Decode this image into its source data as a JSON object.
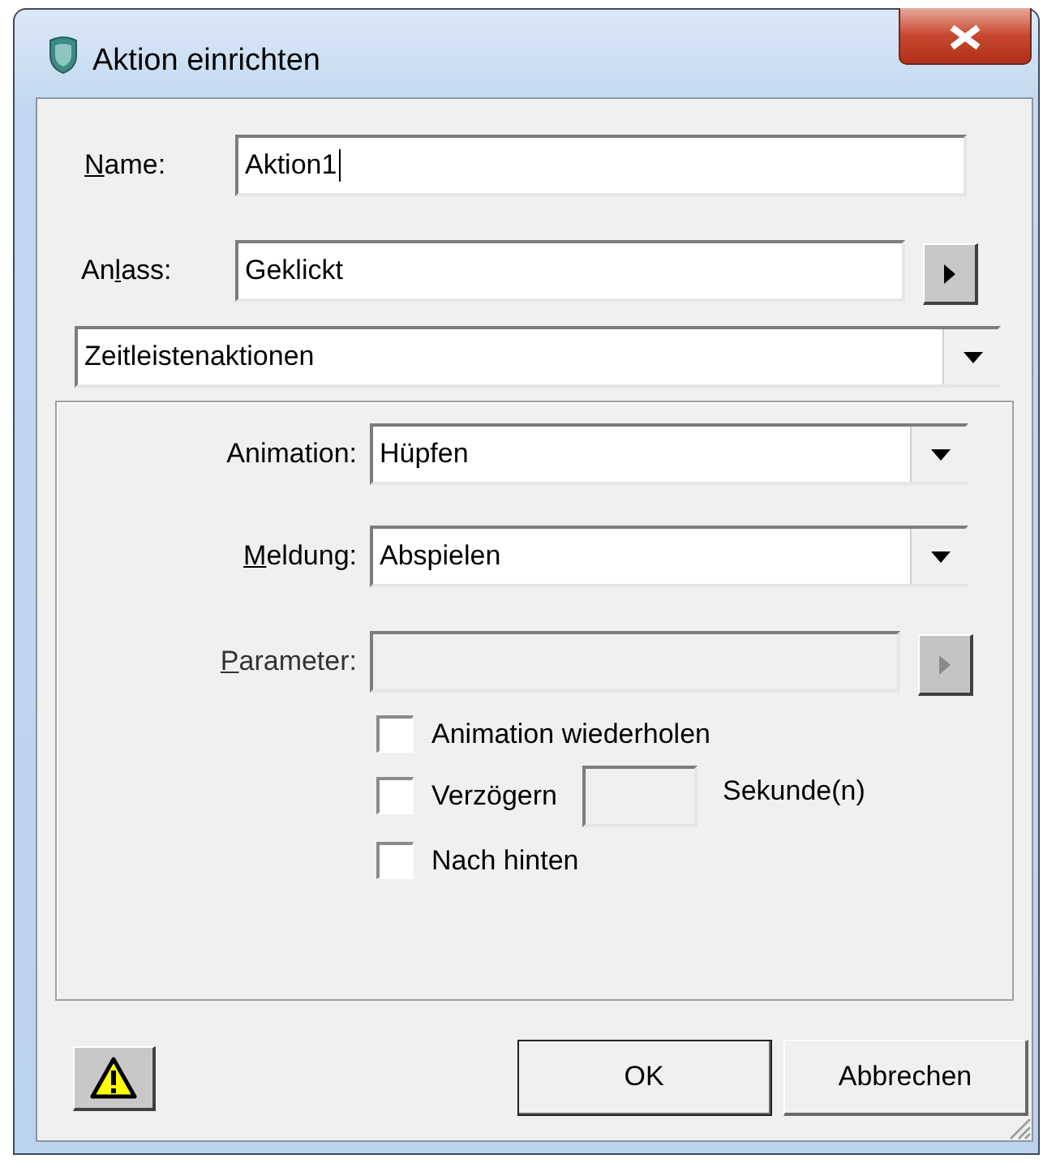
{
  "window": {
    "title": "Aktion einrichten"
  },
  "name_field": {
    "label": [
      {
        "text": "N",
        "underlined": true
      },
      {
        "text": "ame:",
        "underlined": false
      }
    ],
    "value": "Aktion1",
    "focused": true
  },
  "event_field": {
    "label": [
      {
        "text": "An",
        "underlined": false
      },
      {
        "text": "l",
        "underlined": true
      },
      {
        "text": "ass:",
        "underlined": false
      }
    ],
    "value": "Geklickt",
    "disabled": false
  },
  "category": {
    "value": "Zeitleistenaktionen"
  },
  "fields": [
    {
      "kind": "dropdown",
      "label": [
        {
          "text": "Animation:",
          "underlined": false
        }
      ],
      "value": "Hüpfen"
    },
    {
      "kind": "dropdown",
      "label": [
        {
          "text": "M",
          "underlined": true
        },
        {
          "text": "eldung:",
          "underlined": false
        }
      ],
      "value": "Abspielen"
    },
    {
      "kind": "browse",
      "label": [
        {
          "text": "P",
          "underlined": true
        },
        {
          "text": "arameter:",
          "underlined": false
        }
      ],
      "disabled": true
    }
  ],
  "options": [
    {
      "kind": "plain",
      "label": "Animation wiederholen",
      "checked": false
    },
    {
      "kind": "delay",
      "label": "Verzögern",
      "checked": false,
      "unit": "Sekunde(n)"
    },
    {
      "kind": "plain",
      "label": "Nach hinten",
      "checked": false
    }
  ],
  "buttons": [
    {
      "label": "OK",
      "default": true
    },
    {
      "label": "Abbrechen",
      "default": false
    }
  ]
}
